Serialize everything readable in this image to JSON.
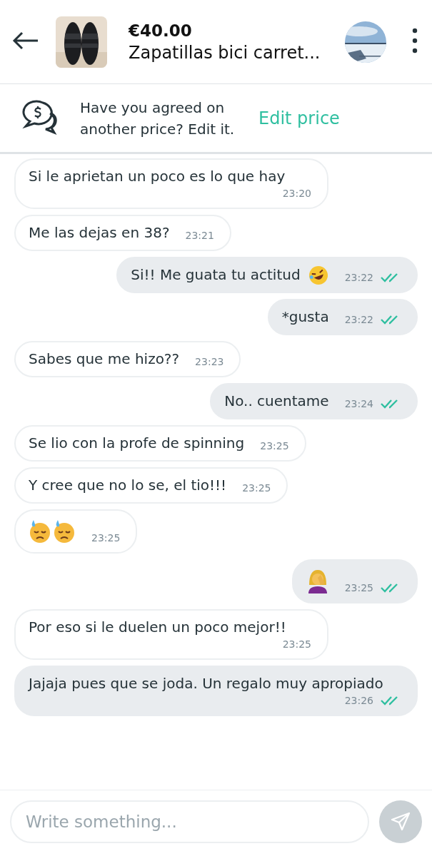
{
  "header": {
    "price": "€40.00",
    "title": "Zapatillas bici carret..."
  },
  "banner": {
    "text": "Have you agreed on another price? Edit it.",
    "action": "Edit price"
  },
  "messages": [
    {
      "outgoing": false,
      "kind": "text",
      "text": "Si le aprietan un poco es lo que hay",
      "time": "23:20"
    },
    {
      "outgoing": false,
      "kind": "text",
      "text": "Me las dejas en 38?",
      "time": "23:21"
    },
    {
      "outgoing": true,
      "kind": "text",
      "text": "Si!! Me guata tu actitud",
      "emojis": [
        {
          "kind": "rofl"
        }
      ],
      "time": "23:22",
      "read": true
    },
    {
      "outgoing": true,
      "kind": "text",
      "text": "*gusta",
      "time": "23:22",
      "read": true
    },
    {
      "outgoing": false,
      "kind": "text",
      "text": "Sabes que me hizo??",
      "time": "23:23"
    },
    {
      "outgoing": true,
      "kind": "text",
      "text": "No.. cuentame",
      "time": "23:24",
      "read": true
    },
    {
      "outgoing": false,
      "kind": "text",
      "text": "Se lio con la profe de spinning",
      "time": "23:25"
    },
    {
      "outgoing": false,
      "kind": "text",
      "text": "Y cree que no lo se, el tio!!!",
      "time": "23:25"
    },
    {
      "outgoing": false,
      "kind": "emoji",
      "emojis": [
        {
          "kind": "sweat"
        },
        {
          "kind": "sweat"
        }
      ],
      "time": "23:25"
    },
    {
      "outgoing": true,
      "kind": "emoji",
      "emojis": [
        {
          "kind": "facepalm"
        }
      ],
      "time": "23:25",
      "read": true
    },
    {
      "outgoing": false,
      "kind": "text",
      "text": "Por eso si le duelen un poco mejor!!",
      "time": "23:25"
    },
    {
      "outgoing": true,
      "kind": "text",
      "text": "Jajaja pues que se joda. Un regalo muy apropiado",
      "time": "23:26",
      "read": true
    }
  ],
  "composer": {
    "placeholder": "Write something..."
  }
}
